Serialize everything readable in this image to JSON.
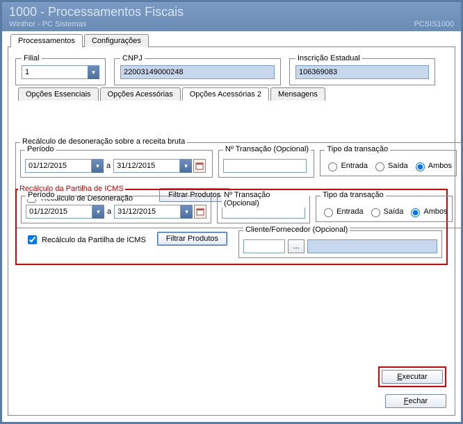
{
  "window": {
    "title": "1000 - Processamentos Fiscais",
    "subtitle_left": "Winthor - PC Sistemas",
    "subtitle_right": "PCSIS1000"
  },
  "main_tabs": [
    "Processamentos",
    "Configurações"
  ],
  "top_fields": {
    "filial_label": "Filial",
    "filial_value": "1",
    "cnpj_label": "CNPJ",
    "cnpj_value": "22003149000248",
    "insc_label": "Inscrição Estadual",
    "insc_value": "106369083"
  },
  "inner_tabs": [
    "Opções Essenciais",
    "Opções Acessórias",
    "Opções Acessórias 2",
    "Mensagens"
  ],
  "section1": {
    "title": "Recálculo de desoneração sobre a receita bruta",
    "periodo_label": "Período",
    "date_from": "01/12/2015",
    "date_sep": "a",
    "date_to": "31/12/2015",
    "trans_label": "Nº Transação (Opcional)",
    "trans_value": "",
    "tipo_label": "Tipo da transação",
    "radio_entrada": "Entrada",
    "radio_saida": "Saída",
    "radio_ambos": "Ambos",
    "chk_label": "Recálculo de Desoneração",
    "chk_checked": false,
    "filtrar_label": "Filtrar Produtos"
  },
  "section2": {
    "title": "Recálculo da Partilha de ICMS",
    "periodo_label": "Período",
    "date_from": "01/12/2015",
    "date_sep": "a",
    "date_to": "31/12/2015",
    "trans_label": "Nº Transação (Opcional)",
    "trans_value": "",
    "tipo_label": "Tipo da transação",
    "radio_entrada": "Entrada",
    "radio_saida": "Saída",
    "radio_ambos": "Ambos",
    "chk_label": "Recálculo da Partilha de ICMS",
    "chk_checked": true,
    "filtrar_label": "Filtrar Produtos",
    "cliente_label": "Cliente/Fornecedor (Opcional)",
    "cliente_value": "",
    "cliente_desc": "",
    "dots": "..."
  },
  "buttons": {
    "executar": "Executar",
    "fechar": "Fechar"
  }
}
